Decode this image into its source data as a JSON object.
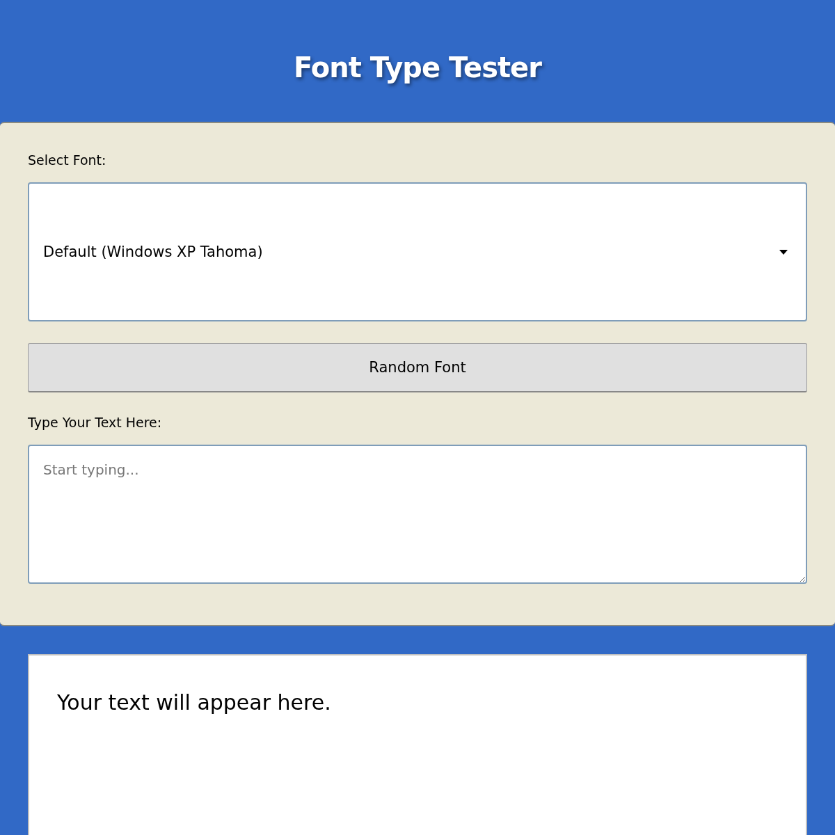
{
  "title": "Font Type Tester",
  "font_select": {
    "label": "Select Font:",
    "value": "Default (Windows XP Tahoma)"
  },
  "random_button": {
    "label": "Random Font"
  },
  "text_input": {
    "label": "Type Your Text Here:",
    "placeholder": "Start typing..."
  },
  "preview": {
    "text": "Your text will appear here."
  }
}
